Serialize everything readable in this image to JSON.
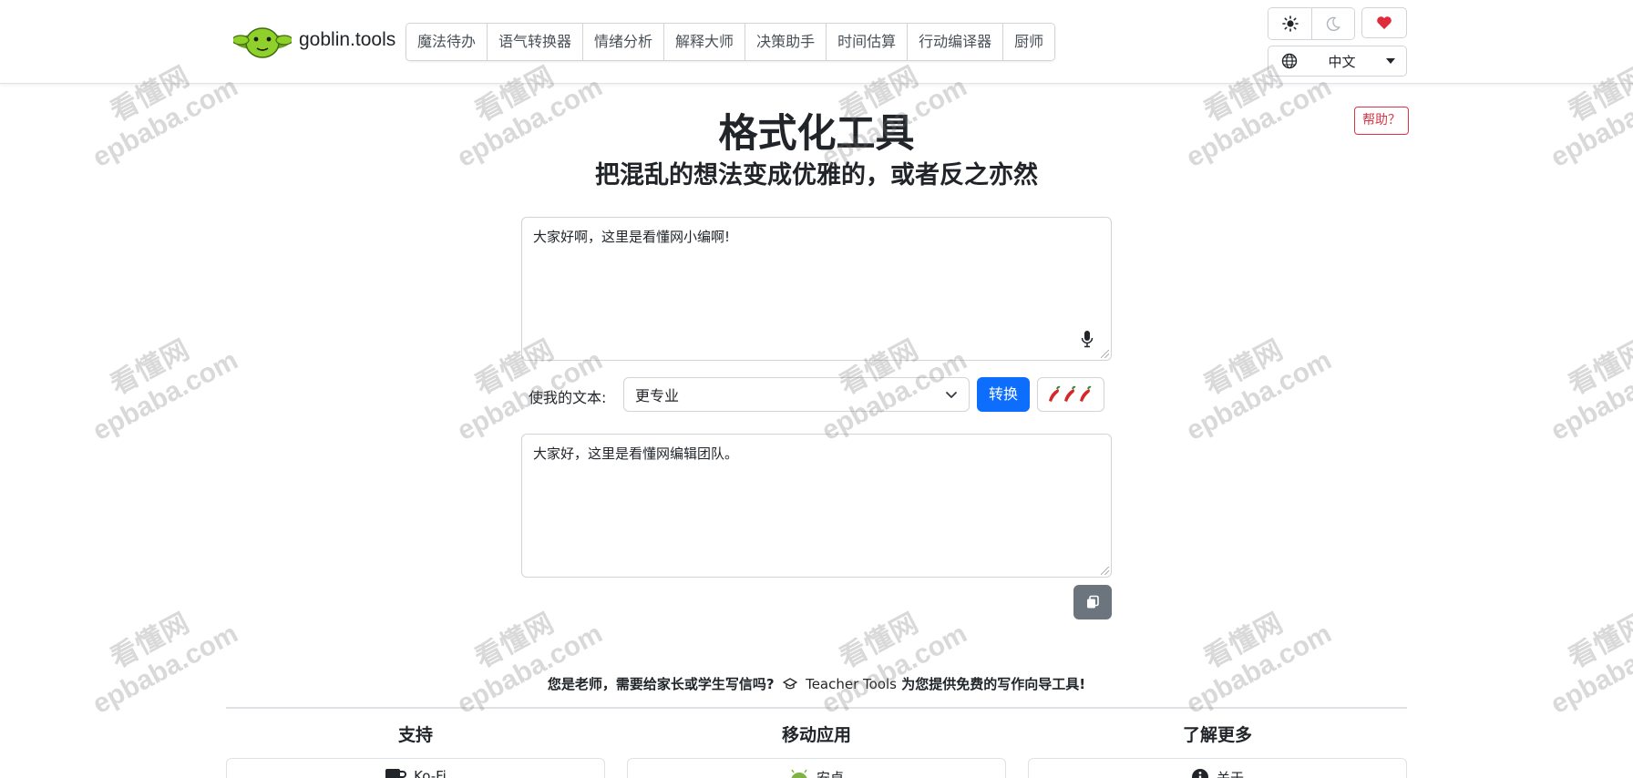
{
  "brand": {
    "name": "goblin.tools"
  },
  "nav": {
    "tabs": [
      {
        "label": "魔法待办"
      },
      {
        "label": "语气转换器"
      },
      {
        "label": "情绪分析"
      },
      {
        "label": "解释大师"
      },
      {
        "label": "决策助手"
      },
      {
        "label": "时间估算"
      },
      {
        "label": "行动编译器"
      },
      {
        "label": "厨师"
      }
    ],
    "theme_light_icon": "sun-icon",
    "theme_dark_icon": "moon-icon",
    "support_icon": "heart-icon",
    "language": {
      "icon": "globe-icon",
      "selected": "中文"
    }
  },
  "help_button": "帮助？",
  "page": {
    "title": "格式化工具",
    "subtitle": "把混乱的想法变成优雅的，或者反之亦然"
  },
  "input": {
    "value": "大家好啊，这里是看懂网小编啊!",
    "mic_icon": "microphone-icon"
  },
  "controls": {
    "make_label": "使我的文本:",
    "style_selected": "更专业",
    "convert_label": "转换",
    "spice_icon": "chili-pepper-icon"
  },
  "output": {
    "value": "大家好，这里是看懂网编辑团队。",
    "copy_icon": "copy-icon"
  },
  "footer": {
    "teacher_prefix": "您是老师，需要给家长或学生写信吗?",
    "teacher_link": "Teacher Tools",
    "teacher_suffix": "为您提供免费的写作向导工具!",
    "columns": [
      {
        "title": "支持",
        "card": "Ko-Fi",
        "icon": "kofi-icon"
      },
      {
        "title": "移动应用",
        "card": "安卓",
        "icon": "android-icon"
      },
      {
        "title": "了解更多",
        "card": "关于",
        "icon": "info-icon"
      }
    ]
  },
  "watermark": {
    "cn": "看懂网",
    "en": "epbaba.com"
  },
  "colors": {
    "primary": "#0d6efd",
    "danger": "#dc3545",
    "secondary": "#6c757d",
    "heart": "#e02b3a"
  }
}
